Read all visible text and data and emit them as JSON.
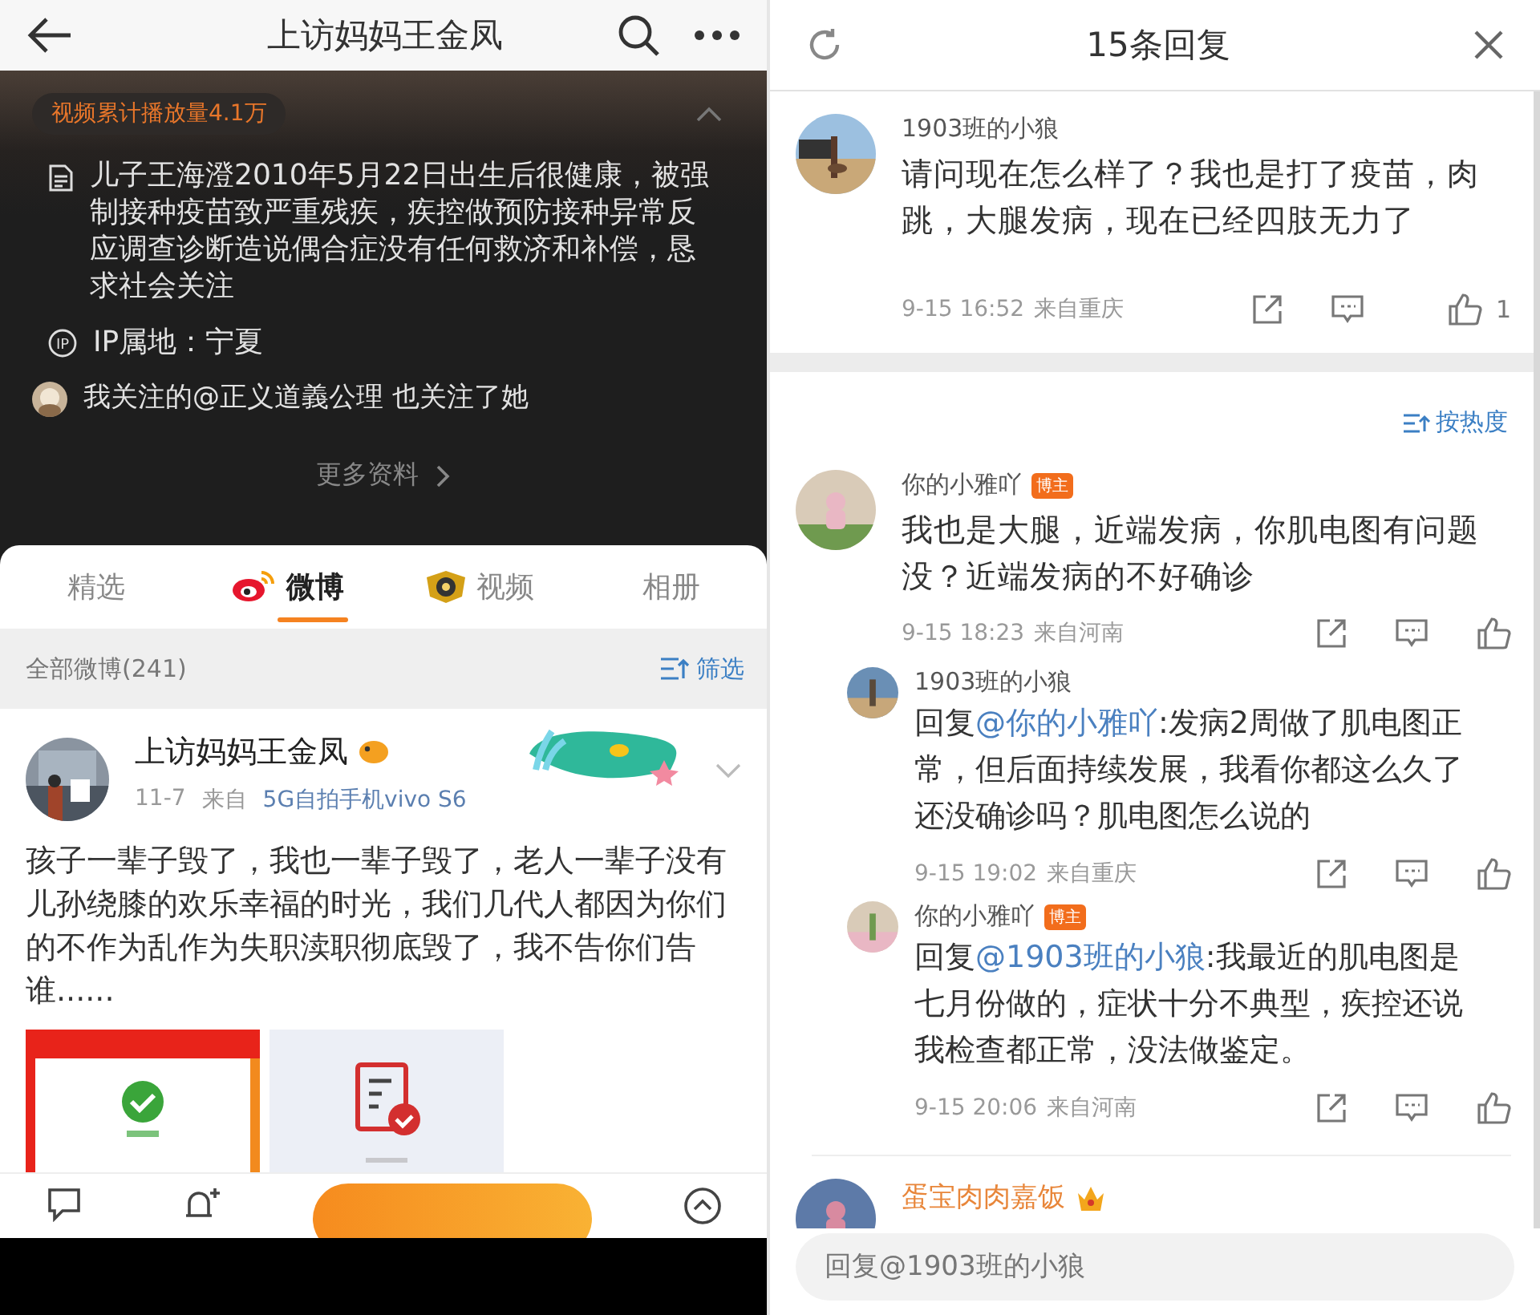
{
  "profile_screen": {
    "title": "上访妈妈王金凤",
    "play_count": "视频累计播放量4.1万",
    "bio": "儿子王海澄2010年5月22日出生后很健康，被强制接种疫苗致严重残疾，疾控做预防接种异常反应调查诊断造说偶合症没有任何救济和补偿，恳求社会关注",
    "ip_icon": "IP",
    "ip_location": "IP属地：宁夏",
    "followed_by": "我关注的@正义道義公理 也关注了她",
    "more_info": "更多资料",
    "tabs": [
      {
        "label": "精选",
        "kind": "plain",
        "selected": false
      },
      {
        "label": "微博",
        "kind": "weibo",
        "selected": true
      },
      {
        "label": "视频",
        "kind": "video",
        "selected": false
      },
      {
        "label": "相册",
        "kind": "plain",
        "selected": false
      }
    ],
    "list_header": {
      "count": "全部微博(241)",
      "filter": "筛选"
    },
    "post": {
      "author": "上访妈妈王金凤",
      "date": "11-7",
      "source_label": "来自",
      "source": "5G自拍手机vivo S6",
      "text": "孩子一辈子毁了，我也一辈子毁了，老人一辈子没有儿孙绕膝的欢乐幸福的时光，我们几代人都因为你们的不作为乱作为失职渎职彻底毁了，我不告你们告谁......",
      "images": [
        {
          "kind": "report"
        },
        {
          "kind": "document"
        }
      ]
    }
  },
  "replies_panel": {
    "title": "15条回复",
    "root_comment": {
      "author": "1903班的小狼",
      "text": "请问现在怎么样了？我也是打了疫苗，肉跳，大腿发病，现在已经四肢无力了",
      "time": "9-15 16:52",
      "location": "来自重庆",
      "likes": "1"
    },
    "sort": "按热度",
    "comments": [
      {
        "author": "你的小雅吖",
        "vip": false,
        "badge": "博主",
        "text": "我也是大腿，近端发病，你肌电图有问题没？近端发病的不好确诊",
        "time": "9-15 18:23",
        "location": "来自河南",
        "replies": [
          {
            "author": "1903班的小狼",
            "prefix": "回复",
            "mention": "@你的小雅吖",
            "text": ":发病2周做了肌电图正常，但后面持续发展，我看你都这么久了还没确诊吗？肌电图怎么说的",
            "time": "9-15 19:02",
            "location": "来自重庆"
          },
          {
            "author": "你的小雅吖",
            "badge": "博主",
            "prefix": "回复",
            "mention": "@1903班的小狼",
            "text": ":我最近的肌电图是七月份做的，症状十分不典型，疾控还说我检查都正常，没法做鉴定。",
            "time": "9-15 20:06",
            "location": "来自河南"
          }
        ]
      },
      {
        "author": "蛋宝肉肉嘉饭",
        "vip": true
      }
    ],
    "input": {
      "placeholder": "回复@1903班的小狼"
    }
  }
}
